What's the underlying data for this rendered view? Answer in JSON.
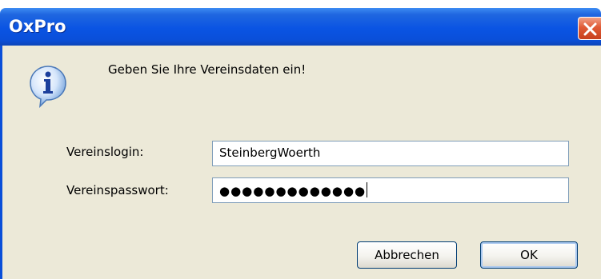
{
  "window": {
    "title": "OxPro",
    "close_icon": "close-icon"
  },
  "dialog": {
    "icon": "info-icon",
    "message": "Geben Sie Ihre Vereinsdaten ein!",
    "fields": [
      {
        "label": "Vereinslogin:",
        "value": "SteinbergWoerth"
      },
      {
        "label": "Vereinspasswort:",
        "value": "●●●●●●●●●●●●●"
      }
    ],
    "buttons": {
      "cancel": "Abbrechen",
      "ok": "OK"
    }
  },
  "colors": {
    "titlebar": "#0a54e3",
    "client_bg": "#ece9d8",
    "close_btn": "#e05b36"
  }
}
